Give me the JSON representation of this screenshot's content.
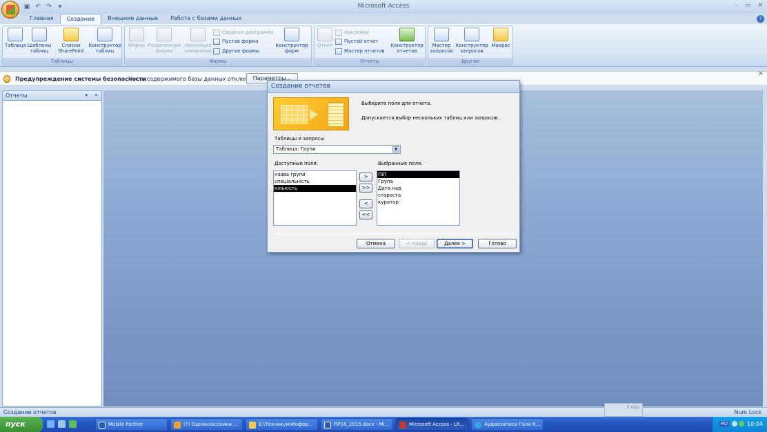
{
  "app_title": "Microsoft Access",
  "ribbon": {
    "tabs": [
      "Главная",
      "Создание",
      "Внешние данные",
      "Работа с базами данных"
    ],
    "active_tab": "Создание",
    "groups": {
      "tables": {
        "label": "Таблицы",
        "buttons": [
          "Таблица",
          "Шаблоны таблиц",
          "Списки SharePoint",
          "Конструктор таблиц"
        ]
      },
      "forms": {
        "label": "Формы",
        "buttons": [
          "Форма",
          "Разделенная форма",
          "Несколько элементов",
          "Конструктор форм"
        ],
        "small": [
          "Сводная диаграмма",
          "Пустая форма",
          "Другие формы"
        ]
      },
      "reports": {
        "label": "Отчеты",
        "buttons": [
          "Отчет",
          "Конструктор отчетов"
        ],
        "small": [
          "Наклейки",
          "Пустой отчет",
          "Мастер отчетов"
        ]
      },
      "other": {
        "label": "Другие",
        "buttons": [
          "Мастер запросов",
          "Конструктор запросов",
          "Макрос"
        ]
      }
    }
  },
  "security_bar": {
    "title": "Предупреждение системы безопасности",
    "text": "Часть содержимого базы данных отключено",
    "button": "Параметры..."
  },
  "nav_pane": {
    "header": "Отчеты"
  },
  "dialog": {
    "title": "Создание отчетов",
    "instruction": "Выберите поля для отчета.",
    "hint": "Допускается выбор нескольких таблиц или запросов.",
    "tables_label": "Таблицы и запросы",
    "tables_value": "Таблица: Групи",
    "available_label": "Доступные поля:",
    "available_fields": [
      "назва групи",
      "спеціальність",
      "кількість"
    ],
    "available_selected": "кількість",
    "selected_label": "Выбранные поля:",
    "selected_fields": [
      "ПІП",
      "Група",
      "Дата нар",
      "староста",
      "куратор"
    ],
    "selected_selected": "ПІП",
    "move_buttons": [
      ">",
      ">>",
      "<",
      "<<"
    ],
    "buttons": {
      "cancel": "Отмена",
      "back": "< Назад",
      "next": "Далее >",
      "finish": "Готово"
    }
  },
  "status_bar": {
    "left": "Создание отчетов",
    "right": "Num Lock"
  },
  "kb_widget": "5 КБ/с",
  "taskbar": {
    "start": "пуск",
    "items": [
      "Mobile Partner",
      "(7) Одноклассники ...",
      "E:\\Техникум\\Инфор...",
      "ПР16_2015.docx - Mi...",
      "Microsoft Access - LR...",
      "Аудиозаписи Гали К..."
    ],
    "active_item": "Microsoft Access - LR...",
    "lang": "RU",
    "clock": "10:04"
  },
  "colors": {
    "ribbon_text": "#15428b",
    "workspace": "#8aa8d2",
    "taskbar": "#2456c2",
    "start_green": "#3b8e33"
  }
}
